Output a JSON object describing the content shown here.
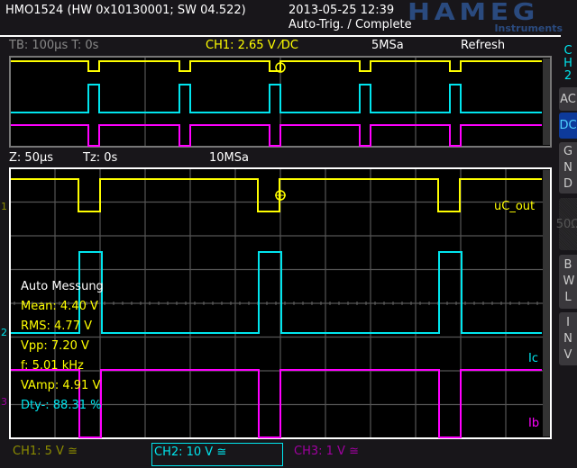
{
  "header": {
    "device": "HMO1524 (HW 0x10130001; SW 04.522)",
    "datetime": "2013-05-25 12:39",
    "trigger_status": "Auto-Trig. / Complete",
    "logo": "HAMEG",
    "logo_sub": "Instruments"
  },
  "status": {
    "timebase": "TB: 100µs  T: 0s",
    "trigger": "CH1: 2.65 V ⁄DC",
    "sample_rate": "5MSa",
    "mode": "Refresh"
  },
  "zoom": {
    "zoom_tb": "Z: 50µs",
    "zoom_t": "Tz: 0s",
    "sample_rate": "10MSa"
  },
  "side": {
    "channel": [
      "C",
      "H",
      "2"
    ],
    "buttons": [
      {
        "label": "AC"
      },
      {
        "label": "DC",
        "active": true
      },
      {
        "label": "GND"
      },
      {
        "label": "50Ω",
        "disabled": true
      },
      {
        "label": "BWL"
      },
      {
        "label": "INV"
      }
    ]
  },
  "markers": {
    "ch1": "1",
    "ch2": "2",
    "ch3": "3"
  },
  "trace_labels": {
    "ch1": "uC_out",
    "ch2": "Ic",
    "ch3": "Ib"
  },
  "measurement": {
    "title": "Auto Messung",
    "mean": "Mean: 4.40 V",
    "rms": "RMS: 4.77 V",
    "vpp": "Vpp: 7.20 V",
    "freq": "f: 5.01 kHz",
    "vamp": "VAmp: 4.91 V",
    "duty": "Dty-: 88.31 %"
  },
  "channels": {
    "ch1": "CH1: 5 V ≅",
    "ch2": "CH2: 10 V ≅",
    "ch3": "CH3: 1 V ≅"
  },
  "colors": {
    "ch1": "#ffff00",
    "ch2": "#00e5ee",
    "ch3": "#ff00ff",
    "ch1_dim": "#8c8c00",
    "ch3_dim": "#a000a0",
    "accent": "#0d3a9a",
    "logo": "#2a4a7e"
  }
}
